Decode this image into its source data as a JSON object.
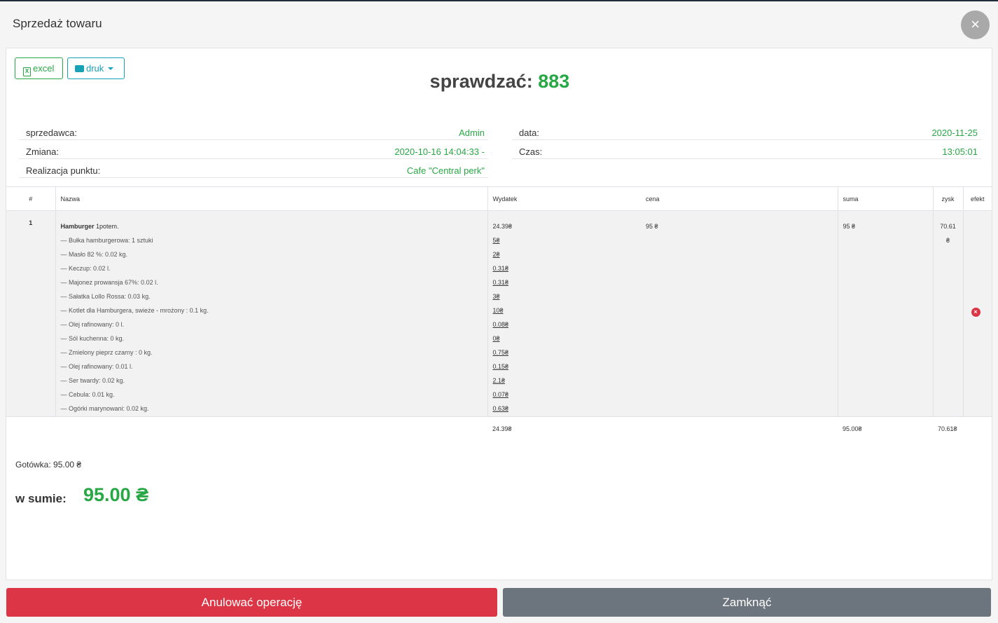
{
  "modal": {
    "title": "Sprzedaż towaru",
    "close_icon": "×"
  },
  "toolbar": {
    "excel_label": "excel",
    "excel_icon": "X",
    "print_label": "druk"
  },
  "check": {
    "label": "sprawdzać:",
    "number": "883"
  },
  "info_left": [
    {
      "label": "sprzedawca:",
      "value": "Admin"
    },
    {
      "label": "Zmiana:",
      "value": "2020-10-16 14:04:33 -"
    },
    {
      "label": "Realizacja punktu:",
      "value": "Cafe \"Central perk\""
    }
  ],
  "info_right": [
    {
      "label": "data:",
      "value": "2020-11-25"
    },
    {
      "label": "Czas:",
      "value": "13:05:01"
    }
  ],
  "table": {
    "headers": {
      "num": "#",
      "name": "Nazwa",
      "expense": "Wydatek",
      "price": "cena",
      "sum": "suma",
      "profit": "zysk",
      "effect": "efekt"
    },
    "rows": [
      {
        "num": "1",
        "product": "Hamburger",
        "qty": "1potem.",
        "expense": "24.39₴",
        "price": "95 ₴",
        "sum": "95 ₴",
        "profit": "70.61",
        "profit_currency": "₴",
        "remove_icon": "×",
        "ingredients": [
          {
            "name": "—  Bułka hamburgerowa: 1 sztuki",
            "cost": "5₴"
          },
          {
            "name": "—  Masło 82 %: 0.02 kg.",
            "cost": "2₴"
          },
          {
            "name": "—  Keczup: 0.02 l.",
            "cost": "0.31₴"
          },
          {
            "name": "—  Majonez prowansja 67%: 0.02 l.",
            "cost": "0.31₴"
          },
          {
            "name": "—  Sałatka Lollo Rossa: 0.03 kg.",
            "cost": "3₴"
          },
          {
            "name": "—  Kotlet dla Hamburgera, swieże - mrożony : 0.1 kg.",
            "cost": "10₴"
          },
          {
            "name": "—  Olej rafinowany: 0 l.",
            "cost": "0.08₴"
          },
          {
            "name": "—  Sól kuchenna: 0 kg.",
            "cost": "0₴"
          },
          {
            "name": "—  Zmielony pieprz czarny : 0 kg.",
            "cost": "0.75₴"
          },
          {
            "name": "—  Olej rafinowany: 0.01 l.",
            "cost": "0.15₴"
          },
          {
            "name": "—  Ser twardy: 0.02 kg.",
            "cost": "2.1₴"
          },
          {
            "name": "—  Cebula: 0.01 kg.",
            "cost": "0.07₴"
          },
          {
            "name": "—  Ogórki marynowani: 0.02 kg.",
            "cost": "0.63₴"
          }
        ]
      }
    ],
    "totals": {
      "expense": "24.39₴",
      "sum": "95.00₴",
      "profit": "70.61₴"
    }
  },
  "payment": {
    "cash": "Gotówka: 95.00 ₴",
    "total_label": "w sumie:",
    "total_value": "95.00 ₴"
  },
  "footer": {
    "cancel_label": "Anulować operację",
    "close_label": "Zamknąć"
  },
  "colors": {
    "accent": "#28a745",
    "danger": "#dc3545",
    "secondary": "#6c757d",
    "info": "#17a2b8"
  }
}
